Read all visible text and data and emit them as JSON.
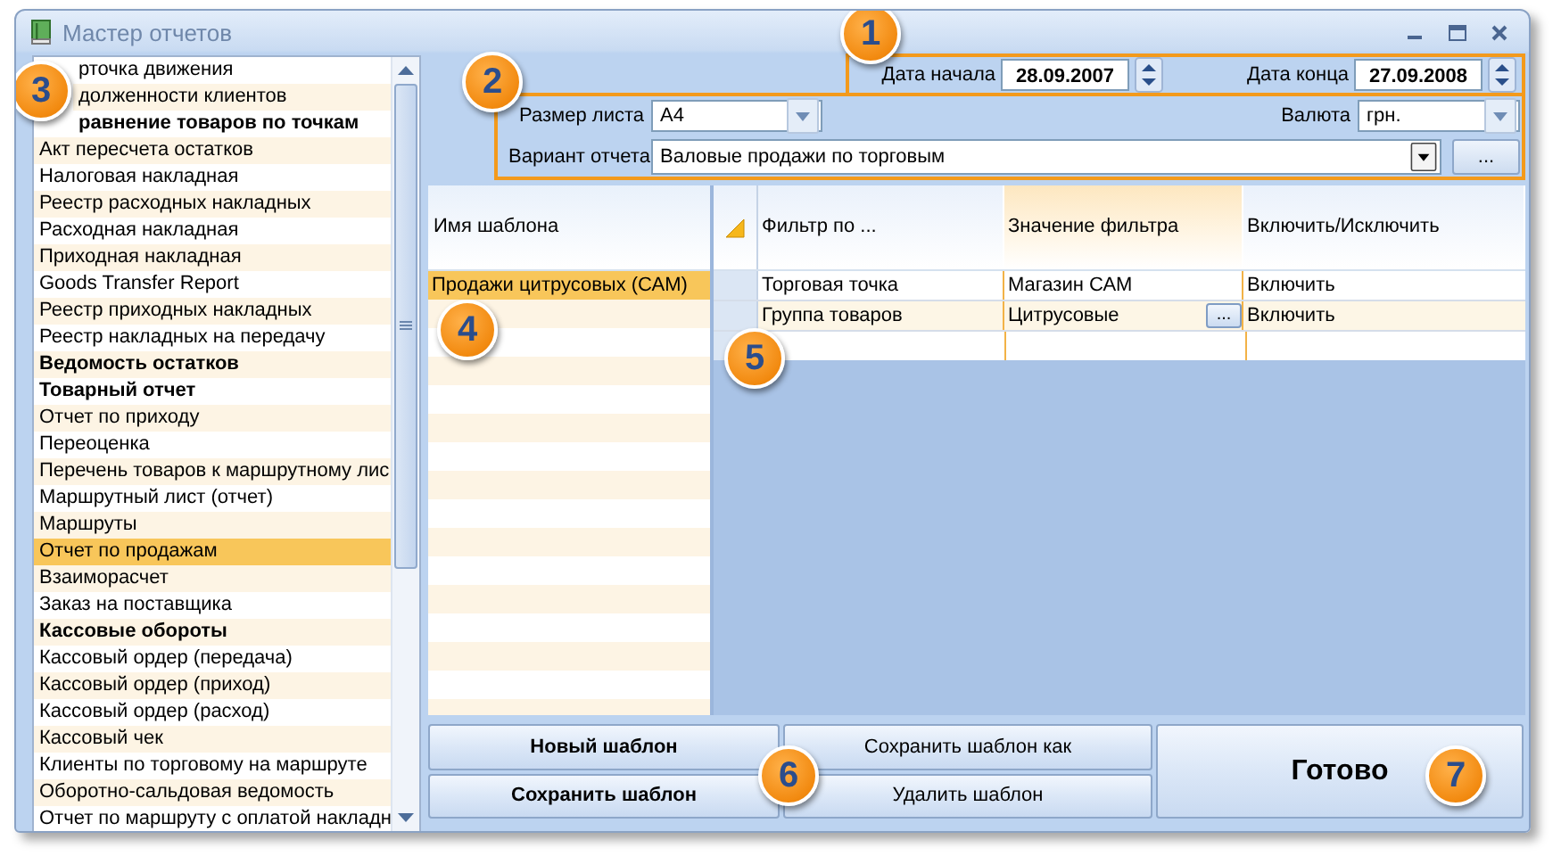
{
  "window": {
    "title": "Мастер отчетов"
  },
  "report_list": {
    "items": [
      {
        "label": "рточка движения",
        "kind": "report",
        "selected": false
      },
      {
        "label": "долженности клиентов",
        "kind": "report",
        "selected": false
      },
      {
        "label": "равнение товаров по точкам",
        "kind": "group",
        "selected": false
      },
      {
        "label": "Акт пересчета остатков",
        "kind": "report",
        "selected": false
      },
      {
        "label": "Налоговая накладная",
        "kind": "report",
        "selected": false
      },
      {
        "label": "Реестр расходных накладных",
        "kind": "report",
        "selected": false
      },
      {
        "label": "Расходная накладная",
        "kind": "report",
        "selected": false
      },
      {
        "label": "Приходная накладная",
        "kind": "report",
        "selected": false
      },
      {
        "label": "Goods Transfer Report",
        "kind": "report",
        "selected": false
      },
      {
        "label": "Реестр приходных накладных",
        "kind": "report",
        "selected": false
      },
      {
        "label": "Реестр накладных на передачу",
        "kind": "report",
        "selected": false
      },
      {
        "label": "Ведомость остатков",
        "kind": "group",
        "selected": false
      },
      {
        "label": "Товарный отчет",
        "kind": "group",
        "selected": false
      },
      {
        "label": "Отчет по приходу",
        "kind": "report",
        "selected": false
      },
      {
        "label": "Переоценка",
        "kind": "report",
        "selected": false
      },
      {
        "label": "Перечень товаров к маршрутному лис",
        "kind": "report",
        "selected": false
      },
      {
        "label": "Маршрутный лист (отчет)",
        "kind": "report",
        "selected": false
      },
      {
        "label": "Маршруты",
        "kind": "report",
        "selected": false
      },
      {
        "label": "Отчет по продажам",
        "kind": "report",
        "selected": true
      },
      {
        "label": "Взаиморасчет",
        "kind": "report",
        "selected": false
      },
      {
        "label": "Заказ на поставщика",
        "kind": "report",
        "selected": false
      },
      {
        "label": "Кассовые обороты",
        "kind": "group",
        "selected": false
      },
      {
        "label": "Кассовый ордер (передача)",
        "kind": "report",
        "selected": false
      },
      {
        "label": "Кассовый ордер (приход)",
        "kind": "report",
        "selected": false
      },
      {
        "label": "Кассовый ордер (расход)",
        "kind": "report",
        "selected": false
      },
      {
        "label": "Кассовый чек",
        "kind": "report",
        "selected": false
      },
      {
        "label": "Клиенты по торговому на маршруте",
        "kind": "report",
        "selected": false
      },
      {
        "label": "Оборотно-сальдовая ведомость",
        "kind": "report",
        "selected": false
      },
      {
        "label": "Отчет по маршруту с оплатой накладн",
        "kind": "report",
        "selected": false
      }
    ]
  },
  "dates": [
    {
      "label": "Дата начала",
      "value": "28.09.2007"
    },
    {
      "label": "Дата конца",
      "value": "27.09.2008"
    }
  ],
  "page_size": {
    "label": "Размер листа",
    "value": "А4"
  },
  "currency": {
    "label": "Валюта",
    "value": "грн."
  },
  "report_variant": {
    "label": "Вариант отчета",
    "value": "Валовые продажи по торговым",
    "button": "..."
  },
  "templates": {
    "header": "Имя шаблона",
    "items": [
      {
        "label": "Продажи цитрусовых (САМ)",
        "selected": true
      }
    ]
  },
  "filter_grid": {
    "columns": [
      {
        "label": "Фильтр по ...",
        "selected": false
      },
      {
        "label": "Значение фильтра",
        "selected": true
      },
      {
        "label": "Включить/Исключить",
        "selected": false
      }
    ],
    "rows": [
      {
        "cells": [
          "Торговая точка",
          "Магазин САМ",
          "Включить"
        ],
        "selected": false
      },
      {
        "cells": [
          "Группа товаров",
          "Цитрусовые",
          "Включить"
        ],
        "selected": true,
        "button": "..."
      }
    ]
  },
  "buttons": [
    {
      "label": "Новый шаблон",
      "kind": "bold"
    },
    {
      "label": "Сохранить шаблон",
      "kind": "bold"
    },
    {
      "label": "Сохранить шаблон как",
      "kind": "plain"
    },
    {
      "label": "Удалить шаблон",
      "kind": "plain"
    },
    {
      "label": "Готово",
      "kind": "large"
    }
  ],
  "callouts": [
    "1",
    "2",
    "3",
    "4",
    "5",
    "6",
    "7"
  ]
}
